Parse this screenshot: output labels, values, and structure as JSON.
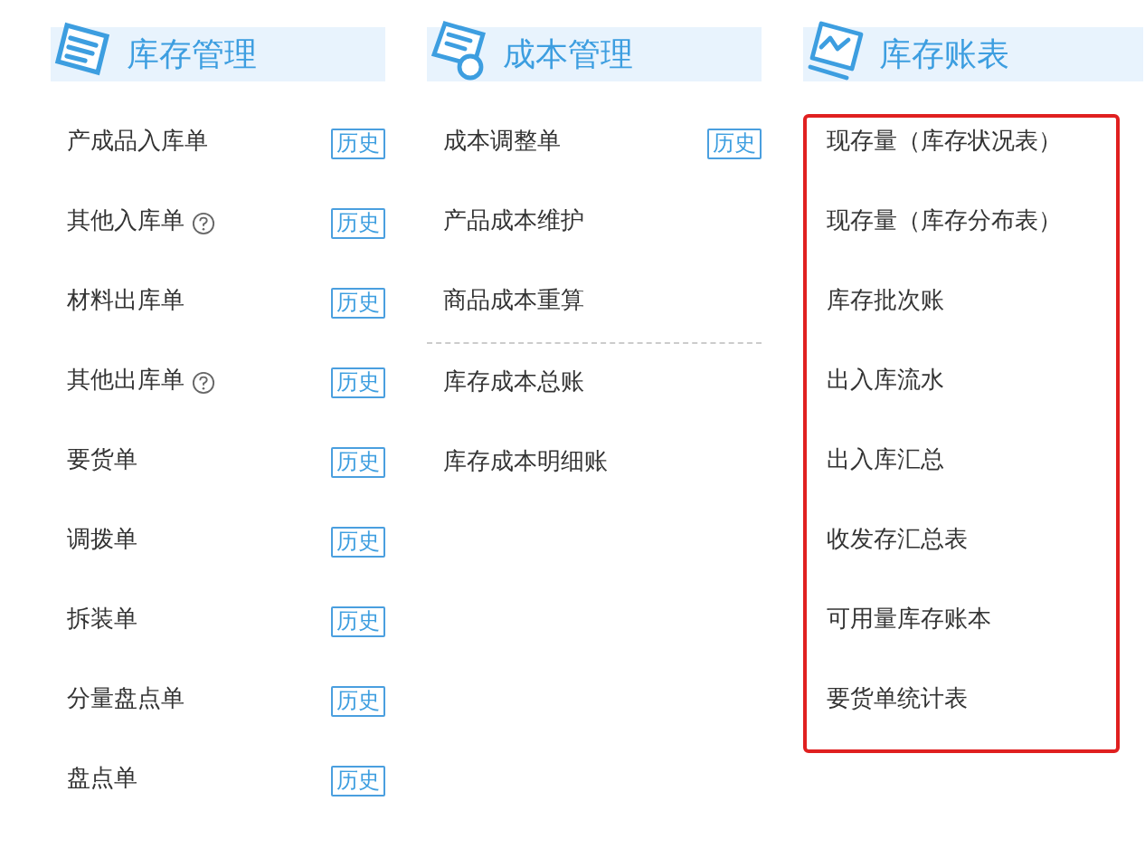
{
  "sections": [
    {
      "title": "库存管理",
      "highlighted": false,
      "groups": [
        [
          {
            "label": "产成品入库单",
            "help": false,
            "history": "历史"
          },
          {
            "label": "其他入库单",
            "help": true,
            "history": "历史"
          },
          {
            "label": "材料出库单",
            "help": false,
            "history": "历史"
          },
          {
            "label": "其他出库单",
            "help": true,
            "history": "历史"
          },
          {
            "label": "要货单",
            "help": false,
            "history": "历史"
          },
          {
            "label": "调拨单",
            "help": false,
            "history": "历史"
          },
          {
            "label": "拆装单",
            "help": false,
            "history": "历史"
          },
          {
            "label": "分量盘点单",
            "help": false,
            "history": "历史"
          },
          {
            "label": "盘点单",
            "help": false,
            "history": "历史"
          }
        ]
      ]
    },
    {
      "title": "成本管理",
      "highlighted": false,
      "groups": [
        [
          {
            "label": "成本调整单",
            "help": false,
            "history": "历史"
          },
          {
            "label": "产品成本维护",
            "help": false
          },
          {
            "label": "商品成本重算",
            "help": false
          }
        ],
        [
          {
            "label": "库存成本总账",
            "help": false
          },
          {
            "label": "库存成本明细账",
            "help": false
          }
        ]
      ]
    },
    {
      "title": "库存账表",
      "highlighted": true,
      "groups": [
        [
          {
            "label": "现存量（库存状况表）",
            "help": false
          },
          {
            "label": "现存量（库存分布表）",
            "help": false
          },
          {
            "label": "库存批次账",
            "help": false
          },
          {
            "label": "出入库流水",
            "help": false
          },
          {
            "label": "出入库汇总",
            "help": false
          },
          {
            "label": "收发存汇总表",
            "help": false
          },
          {
            "label": "可用量库存账本",
            "help": false
          },
          {
            "label": "要货单统计表",
            "help": false
          }
        ]
      ]
    }
  ]
}
